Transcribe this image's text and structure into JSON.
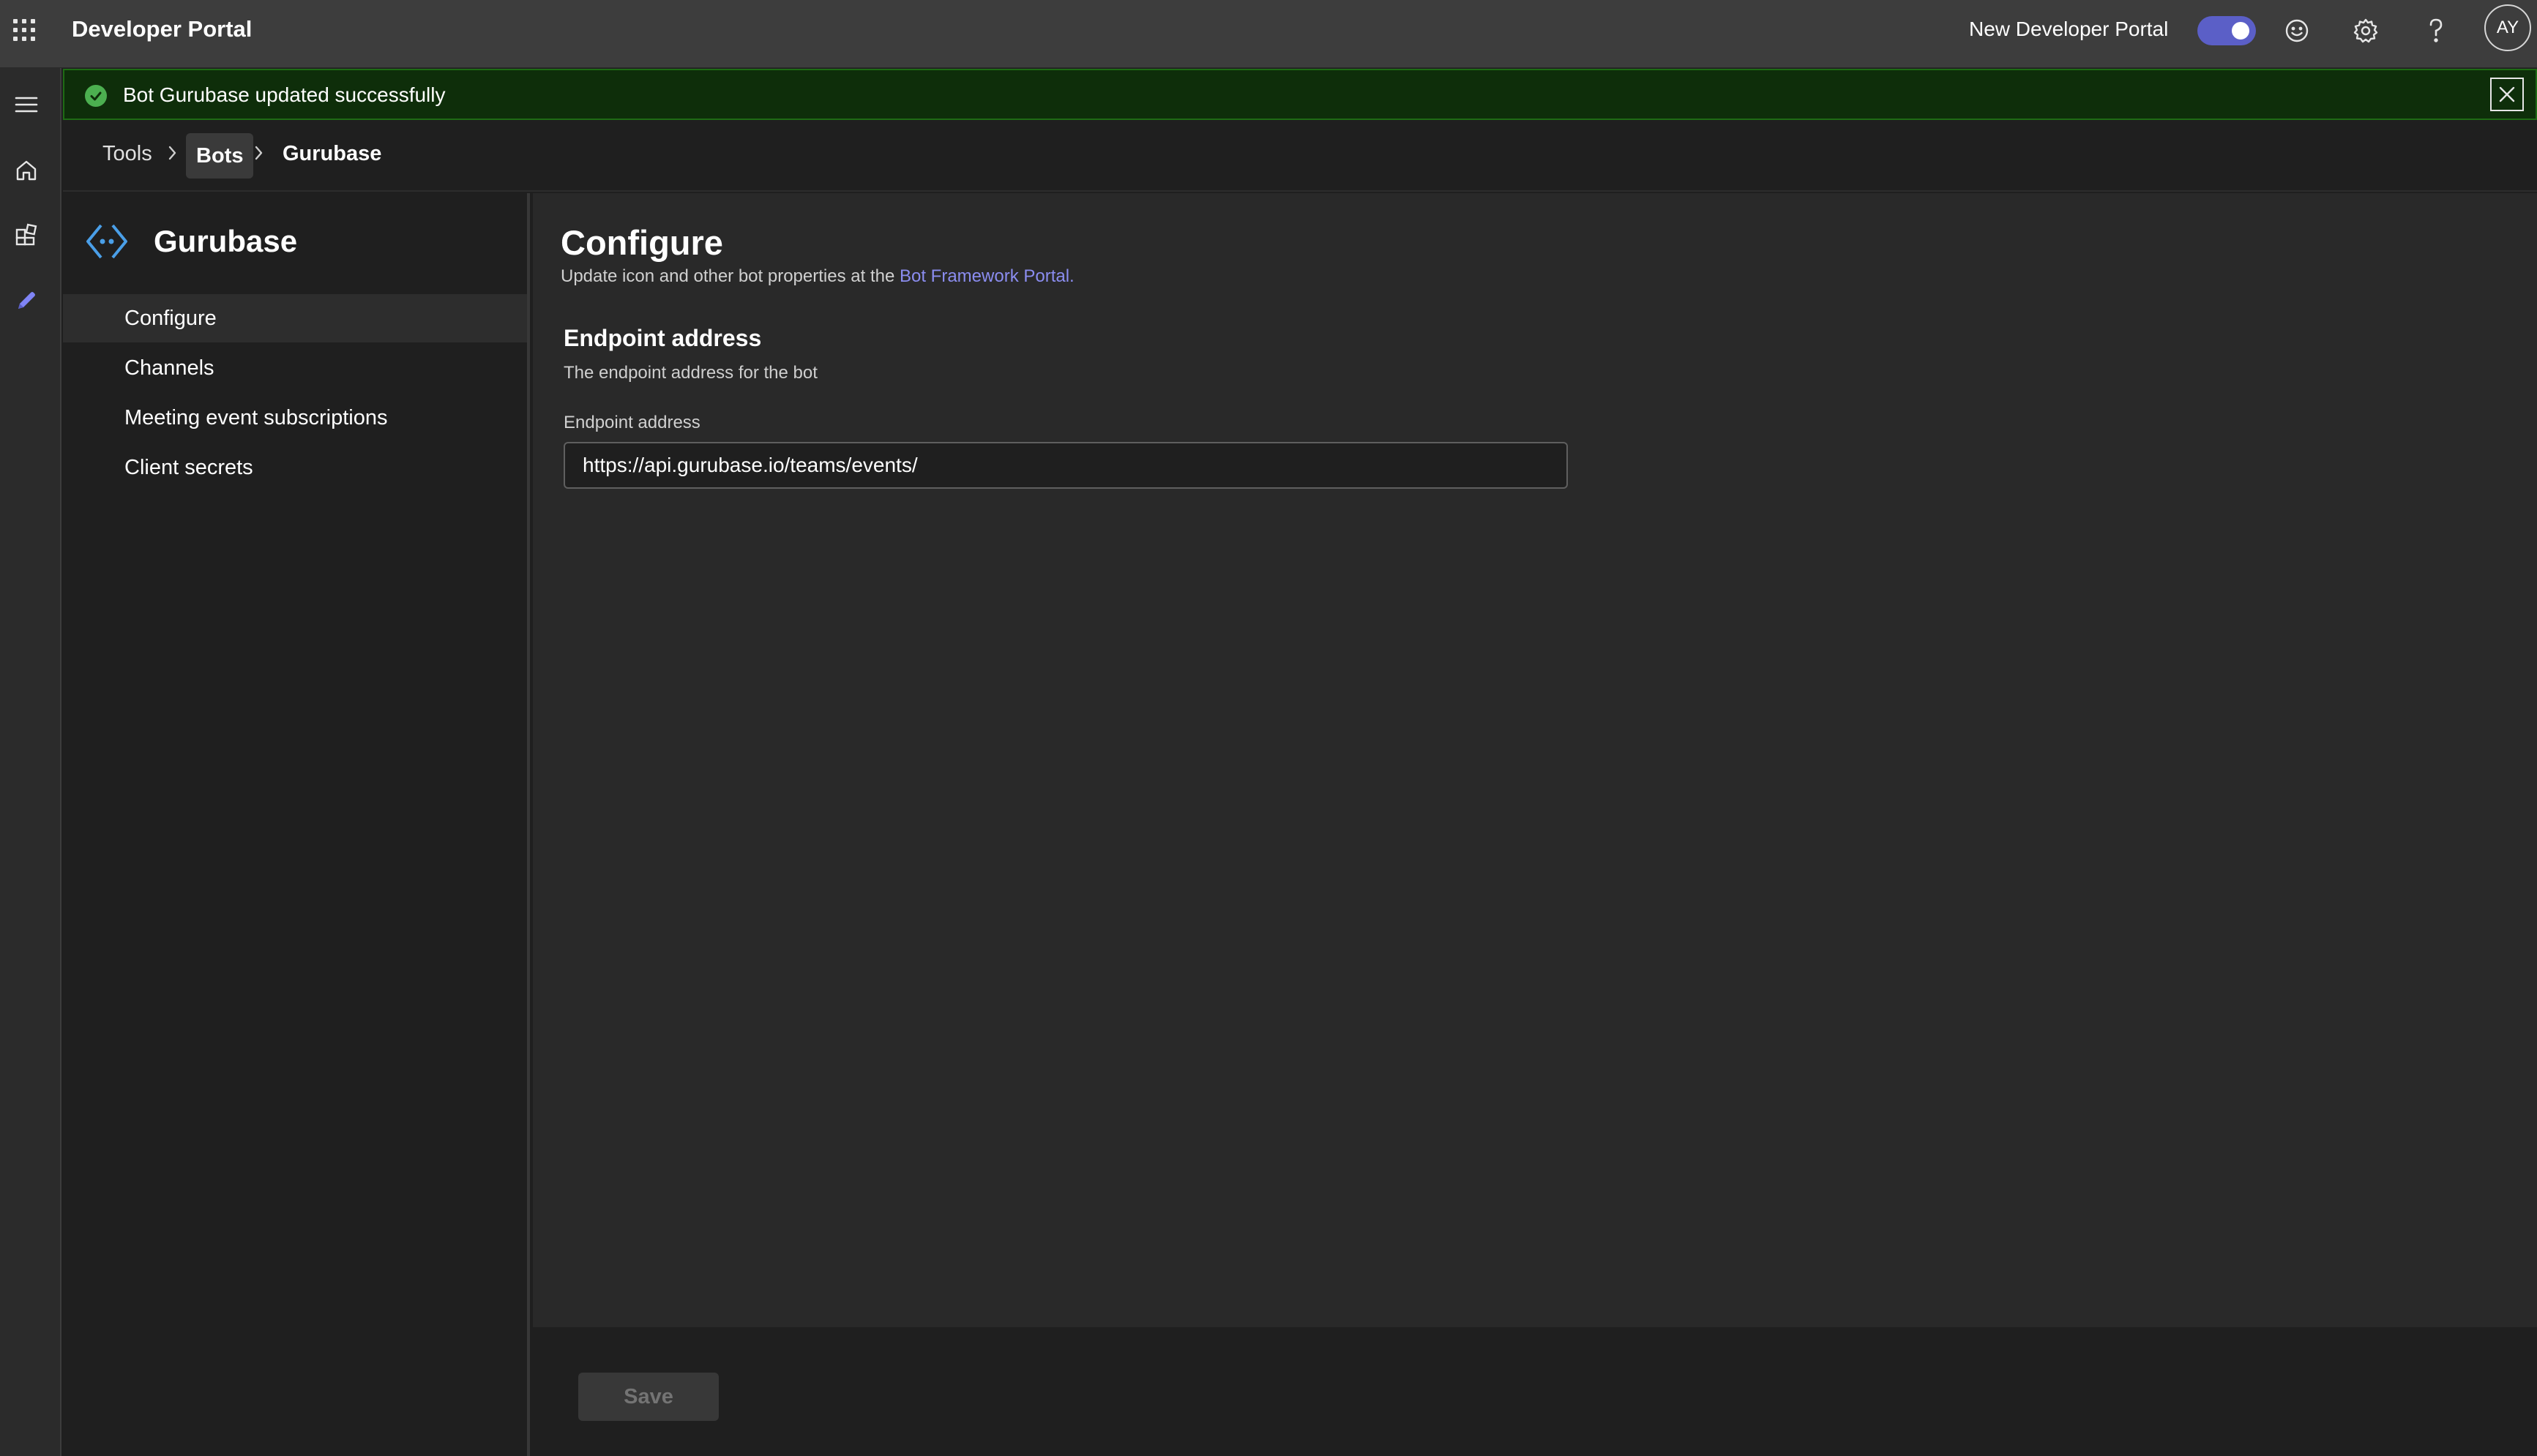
{
  "header": {
    "app_title": "Developer Portal",
    "new_portal_label": "New Developer Portal",
    "new_portal_toggle_on": true,
    "avatar_initials": "AY",
    "icons": [
      "app-launcher-icon",
      "smiley-icon",
      "gear-icon",
      "help-icon"
    ]
  },
  "rail": {
    "items": [
      "hamburger-menu-icon",
      "home-icon",
      "apps-icon",
      "pencil-icon"
    ]
  },
  "banner": {
    "message": "Bot Gurubase updated successfully",
    "status_color": "#4caf50"
  },
  "breadcrumb": {
    "items": [
      "Tools",
      "Bots",
      "Gurubase"
    ]
  },
  "leftnav": {
    "bot_name": "Gurubase",
    "items": [
      {
        "label": "Configure",
        "active": true
      },
      {
        "label": "Channels",
        "active": false
      },
      {
        "label": "Meeting event subscriptions",
        "active": false
      },
      {
        "label": "Client secrets",
        "active": false
      }
    ]
  },
  "main": {
    "title": "Configure",
    "subtitle_prefix": "Update icon and other bot properties at the ",
    "subtitle_link": "Bot Framework Portal.",
    "section_title": "Endpoint address",
    "section_desc": "The endpoint address for the bot",
    "field_label": "Endpoint address",
    "field_value": "https://api.gurubase.io/teams/events/"
  },
  "footer": {
    "save_label": "Save"
  },
  "colors": {
    "accent": "#5b5fc7",
    "link": "#8b8df0",
    "bot_icon": "#4a9fe8"
  }
}
